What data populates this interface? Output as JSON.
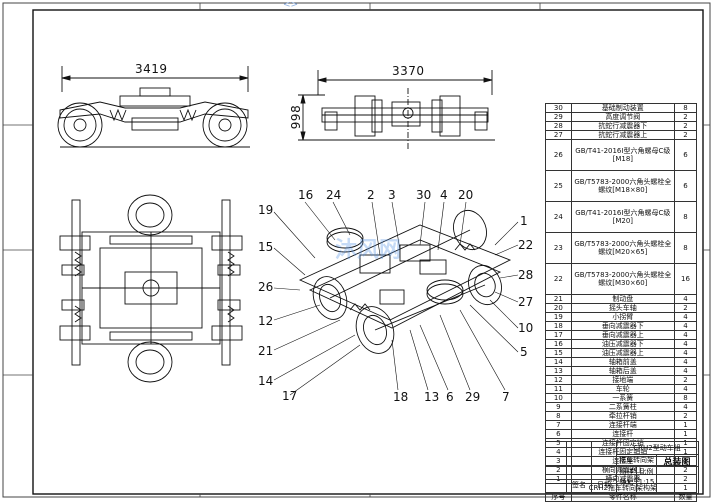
{
  "watermark": {
    "top": "<>",
    "center": "沐风网",
    "tagline": "www.mfcad.com"
  },
  "dimensions": {
    "side_length": "3419",
    "front_width": "3370",
    "front_height": "998"
  },
  "callouts": {
    "c16": "16",
    "c24": "24",
    "c2": "2",
    "c3": "3",
    "c30": "30",
    "c4": "4",
    "c20": "20",
    "c19": "19",
    "c15": "15",
    "c26": "26",
    "c12": "12",
    "c21": "21",
    "c14": "14",
    "c17": "17",
    "c1": "1",
    "c22": "22",
    "c28": "28",
    "c27": "27",
    "c10": "10",
    "c5": "5",
    "c18": "18",
    "c13": "13",
    "c6": "6",
    "c29": "29",
    "c7": "7"
  },
  "bom": [
    {
      "no": "30",
      "name": "基础制动装置",
      "qty": "8"
    },
    {
      "no": "29",
      "name": "高度调节阀",
      "qty": "2"
    },
    {
      "no": "28",
      "name": "抗蛇行减震器下",
      "qty": "2"
    },
    {
      "no": "27",
      "name": "抗蛇行减震器上",
      "qty": "2"
    },
    {
      "no": "26",
      "name": "GB/T41-2016I型六角螺母C级[M18]",
      "qty": "6"
    },
    {
      "no": "25",
      "name": "GB/T5783-2000六角头螺栓全螺纹[M18×80]",
      "qty": "6"
    },
    {
      "no": "24",
      "name": "GB/T41-2016I型六角螺母C级[M20]",
      "qty": "8"
    },
    {
      "no": "23",
      "name": "GB/T5783-2000六角头螺栓全螺纹[M20×65]",
      "qty": "8"
    },
    {
      "no": "22",
      "name": "GB/T5783-2000六角头螺栓全螺纹[M30×60]",
      "qty": "16"
    },
    {
      "no": "21",
      "name": "制动盘",
      "qty": "4"
    },
    {
      "no": "20",
      "name": "摇头车轴",
      "qty": "2"
    },
    {
      "no": "19",
      "name": "小拐臂",
      "qty": "4"
    },
    {
      "no": "18",
      "name": "垂向减震器下",
      "qty": "4"
    },
    {
      "no": "17",
      "name": "垂向减震器上",
      "qty": "4"
    },
    {
      "no": "16",
      "name": "油压减震器下",
      "qty": "4"
    },
    {
      "no": "15",
      "name": "油压减震器上",
      "qty": "4"
    },
    {
      "no": "14",
      "name": "轴箱前盖",
      "qty": "4"
    },
    {
      "no": "13",
      "name": "轴箱后盖",
      "qty": "4"
    },
    {
      "no": "12",
      "name": "接地端",
      "qty": "2"
    },
    {
      "no": "11",
      "name": "车轮",
      "qty": "4"
    },
    {
      "no": "10",
      "name": "一系簧",
      "qty": "8"
    },
    {
      "no": "9",
      "name": "二系簧柱",
      "qty": "4"
    },
    {
      "no": "8",
      "name": "牵拉杆销",
      "qty": "2"
    },
    {
      "no": "7",
      "name": "连接杆端",
      "qty": "1"
    },
    {
      "no": "6",
      "name": "连接杆",
      "qty": "1"
    },
    {
      "no": "5",
      "name": "连接杆固定销",
      "qty": "1"
    },
    {
      "no": "4",
      "name": "连接杆固定销销",
      "qty": "1"
    },
    {
      "no": "3",
      "name": "连接座",
      "qty": "1"
    },
    {
      "no": "2",
      "name": "横向减震器上",
      "qty": "2"
    },
    {
      "no": "1",
      "name": "横向减震器",
      "qty": "2"
    },
    {
      "no": "",
      "name": "CRH2拖车转向架构架",
      "qty": "1"
    }
  ],
  "bom_header": {
    "no": "序号",
    "name": "零件名称",
    "qty": "数量"
  },
  "title_block": {
    "drawing_title_1": "CRH2型动车组",
    "drawing_title_2": "拖车转向架",
    "drawing_type": "总装图",
    "scale_label": "比例",
    "scale_value": "1:15",
    "sheet_label": "图样标记",
    "mark": "A1",
    "weight_label": "重量",
    "weight_value": "",
    "name_header": "签名",
    "date_header": "日期"
  }
}
